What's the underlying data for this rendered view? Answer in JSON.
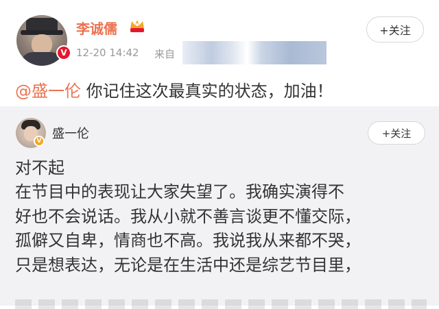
{
  "post": {
    "username": "李诚儒",
    "timestamp": "12-20 14:42",
    "source_prefix": "来自",
    "follow_label": "+关注",
    "mention": "@盛一伦",
    "text": " 你记住这次最真实的状态，加油！"
  },
  "repost": {
    "username": "盛一伦",
    "follow_label": "+关注",
    "lines": [
      "对不起",
      "在节目中的表现让大家失望了。我确实演得不",
      "好也不会说话。我从小就不善言谈更不懂交际，",
      "孤僻又自卑，情商也不高。我说我从来都不哭，",
      "只是想表达，无论是在生活中还是综艺节目里，"
    ]
  },
  "icons": {
    "verified_main": "verified-v-icon",
    "verified_sub": "verified-v-icon",
    "vip_crown": "crown-icon"
  },
  "colors": {
    "username": "#eb7350",
    "mention": "#eb7350",
    "verified": "#f5a623",
    "background_repost": "#f2f2f5"
  }
}
